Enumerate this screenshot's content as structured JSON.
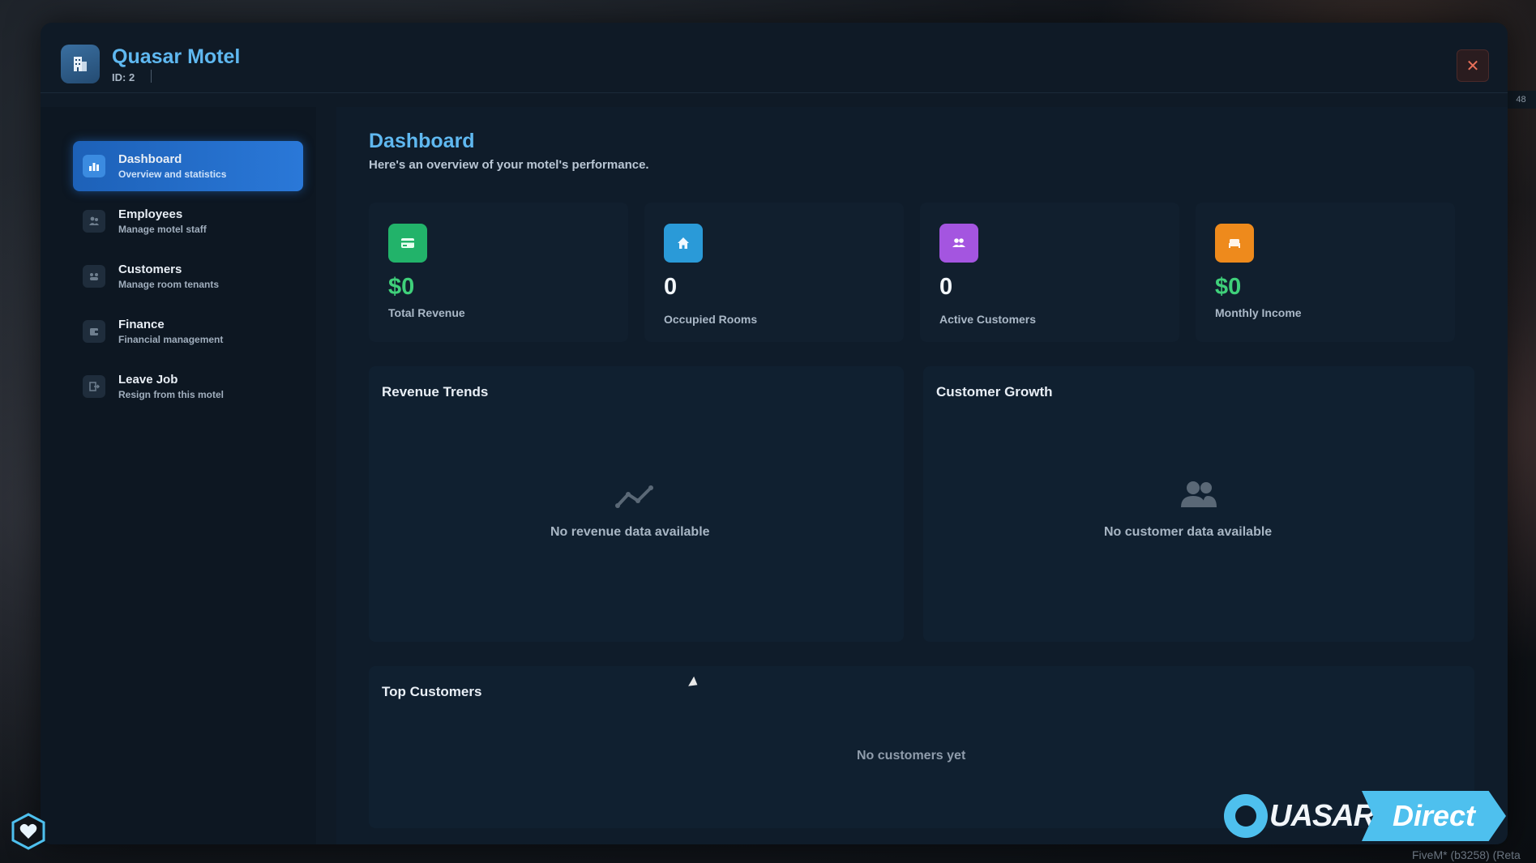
{
  "app": {
    "title": "Quasar Motel",
    "id_label": "ID: 2",
    "close_symbol": "✕"
  },
  "sidebar": {
    "items": [
      {
        "label": "Dashboard",
        "sub": "Overview and statistics",
        "icon": "chart-icon",
        "active": true
      },
      {
        "label": "Employees",
        "sub": "Manage motel staff",
        "icon": "users-icon",
        "active": false
      },
      {
        "label": "Customers",
        "sub": "Manage room tenants",
        "icon": "customers-icon",
        "active": false
      },
      {
        "label": "Finance",
        "sub": "Financial management",
        "icon": "wallet-icon",
        "active": false
      },
      {
        "label": "Leave Job",
        "sub": "Resign from this motel",
        "icon": "exit-icon",
        "active": false
      }
    ]
  },
  "main": {
    "title": "Dashboard",
    "subtitle": "Here's an overview of your motel's performance.",
    "stats": [
      {
        "value": "$0",
        "label": "Total Revenue",
        "icon": "card-icon",
        "color": "#22b36a",
        "value_color": "#3fd07a"
      },
      {
        "value": "0",
        "label": "Occupied Rooms",
        "icon": "home-icon",
        "color": "#2a9ad8",
        "value_color": "#f2f6fa"
      },
      {
        "value": "0",
        "label": "Active Customers",
        "icon": "users-icon",
        "color": "#a455e0",
        "value_color": "#f2f6fa"
      },
      {
        "value": "$0",
        "label": "Monthly Income",
        "icon": "bed-icon",
        "color": "#ee8a1c",
        "value_color": "#3fd07a"
      }
    ],
    "revenue_panel": {
      "title": "Revenue Trends",
      "empty": "No revenue data available"
    },
    "growth_panel": {
      "title": "Customer Growth",
      "empty": "No customer data available"
    },
    "top_panel": {
      "title": "Top Customers",
      "empty": "No customers yet"
    }
  },
  "overlay": {
    "brand_left": "UASAR",
    "brand_right": "Direct",
    "side_badge": "48",
    "footer": "FiveM* (b3258) (Reta"
  },
  "colors": {
    "accent": "#5fb8f0",
    "active_nav": "#2a78d8",
    "close": "#e8705a"
  }
}
